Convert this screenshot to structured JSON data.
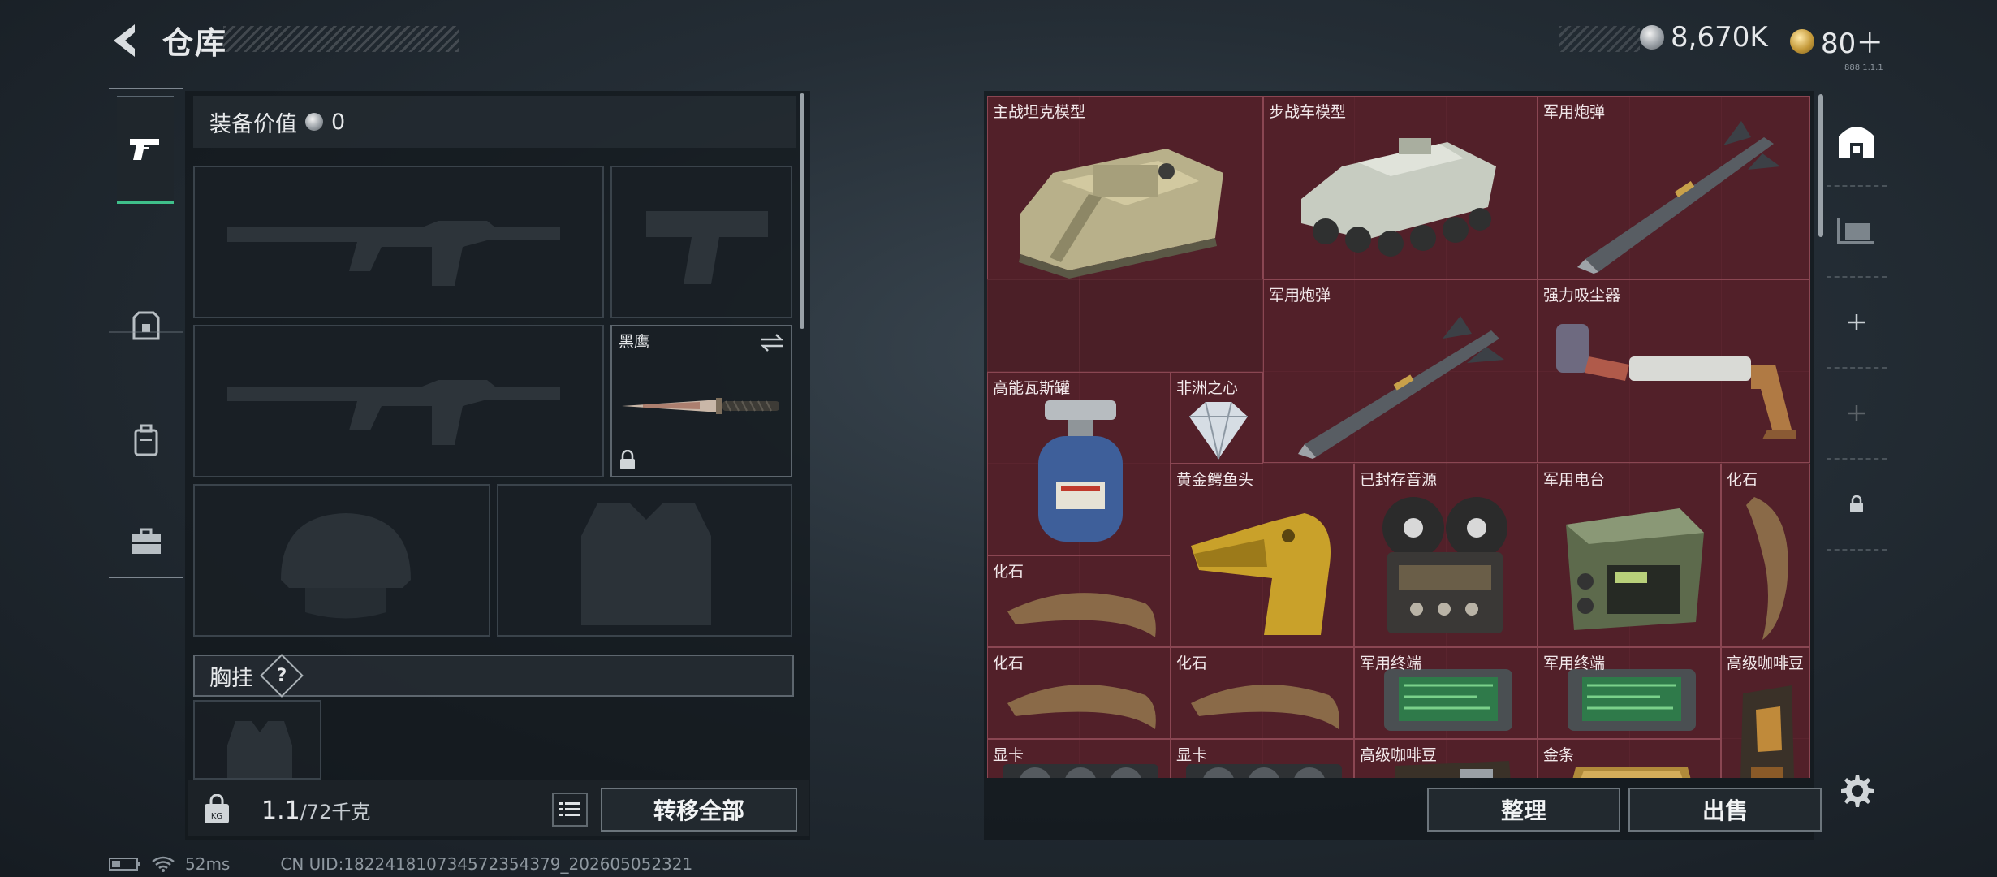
{
  "header": {
    "title": "仓库",
    "silver_amount": "8,670K",
    "gold_amount": "80＋",
    "tiny_text": "888 1.1.1"
  },
  "equipment": {
    "value_label": "装备价值",
    "value_amount": "0",
    "knife_slot_label": "黑鹰",
    "chest_label": "胸挂",
    "chest_help": "?"
  },
  "bottom_left": {
    "weight_current": "1.1",
    "weight_max": "/72千克",
    "transfer_all": "转移全部"
  },
  "inventory": {
    "items": [
      {
        "label": "主战坦克模型"
      },
      {
        "label": "步战车模型"
      },
      {
        "label": "军用炮弹"
      },
      {
        "label": "军用炮弹"
      },
      {
        "label": "强力吸尘器"
      },
      {
        "label": "高能瓦斯罐"
      },
      {
        "label": "非洲之心"
      },
      {
        "label": "黄金鳄鱼头"
      },
      {
        "label": "已封存音源"
      },
      {
        "label": "军用电台"
      },
      {
        "label": "化石"
      },
      {
        "label": "化石"
      },
      {
        "label": "化石"
      },
      {
        "label": "化石"
      },
      {
        "label": "军用终端"
      },
      {
        "label": "军用终端"
      },
      {
        "label": "高级咖啡豆"
      },
      {
        "label": "显卡"
      },
      {
        "label": "显卡"
      },
      {
        "label": "高级咖啡豆"
      },
      {
        "label": "金条"
      }
    ],
    "sort_button": "整理",
    "sell_button": "出售"
  },
  "status_bar": {
    "ping": "52ms",
    "uid": "CN UID:18224181073457235437​9_202605052321"
  },
  "colors": {
    "accent_green": "#3fbf8a",
    "inventory_bg": "#4b1f27"
  },
  "icons": [
    "back-arrow-icon",
    "silver-coin-icon",
    "gold-coin-icon",
    "pistol-icon",
    "armor-icon",
    "backpack-icon",
    "toolbox-icon",
    "swap-icon",
    "lock-icon",
    "weight-icon",
    "list-icon",
    "storage-icon",
    "hand-cart-icon",
    "plus-icon",
    "gear-icon",
    "battery-icon",
    "wifi-icon"
  ]
}
